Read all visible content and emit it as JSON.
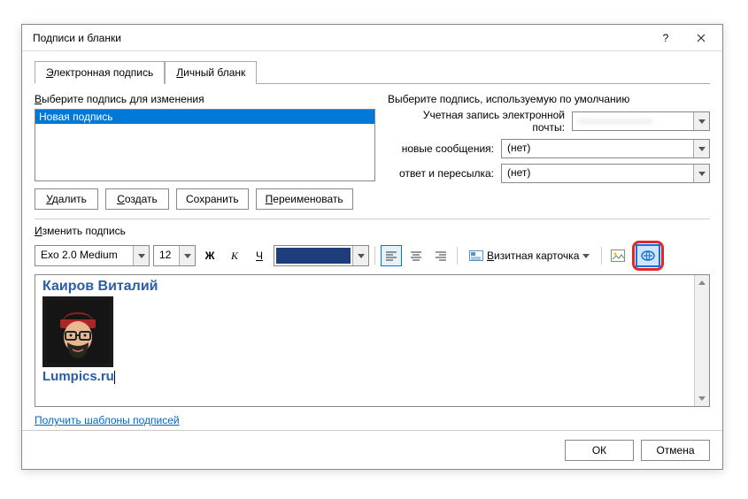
{
  "window": {
    "title": "Подписи и бланки"
  },
  "tabs": {
    "active": "Электронная подпись",
    "inactive": "Личный бланк"
  },
  "left": {
    "select_label": "Выберите подпись для изменения",
    "signature_name": "Новая подпись",
    "btn_delete": "Удалить",
    "btn_new": "Создать",
    "btn_save": "Сохранить",
    "btn_rename": "Переименовать"
  },
  "right": {
    "heading": "Выберите подпись, используемую по умолчанию",
    "account_label": "Учетная запись электронной почты:",
    "account_value": "———————",
    "newmsg_label": "новые сообщения:",
    "newmsg_value": "(нет)",
    "reply_label": "ответ и пересылка:",
    "reply_value": "(нет)"
  },
  "edit": {
    "label": "Изменить подпись",
    "font": "Exo 2.0 Medium",
    "size": "12",
    "bold": "Ж",
    "italic": "К",
    "underline": "Ч",
    "bizcard": "Визитная карточка"
  },
  "content": {
    "name": "Каиров Виталий",
    "site": "Lumpics.ru"
  },
  "templates_link": "Получить шаблоны подписей",
  "footer": {
    "ok": "ОК",
    "cancel": "Отмена"
  }
}
